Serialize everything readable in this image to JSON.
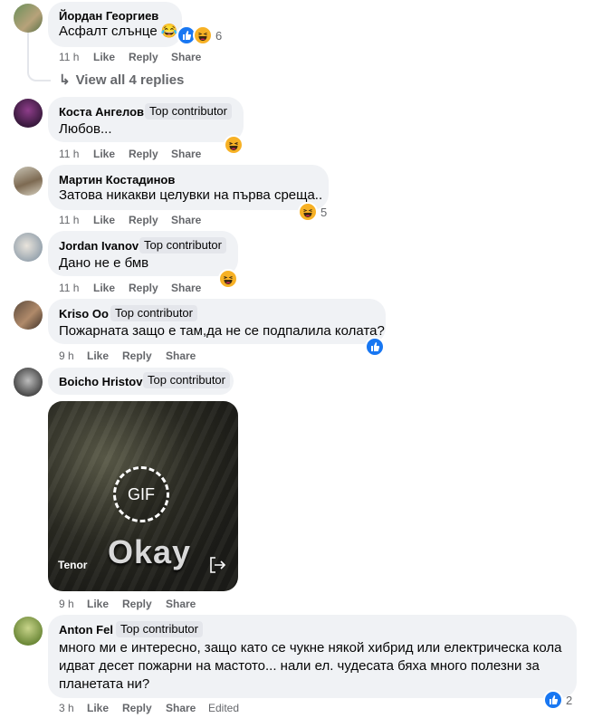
{
  "comments": [
    {
      "name": "Йордан Георгиев",
      "badge": "",
      "text": [
        "Асфалт слънце 😂"
      ],
      "time": "11 h",
      "like": "Like",
      "reply": "Reply",
      "share": "Share",
      "reactions": [
        "like",
        "haha"
      ],
      "count": "6"
    },
    {
      "name": "Коста Ангелов",
      "badge": "Top contributor",
      "text": [
        "Любов..."
      ],
      "time": "11 h",
      "like": "Like",
      "reply": "Reply",
      "share": "Share",
      "reactions": [
        "haha"
      ],
      "count": ""
    },
    {
      "name": "Мартин Костадинов",
      "badge": "",
      "text": [
        "Затова никакви целувки на първа среща.."
      ],
      "time": "11 h",
      "like": "Like",
      "reply": "Reply",
      "share": "Share",
      "reactions": [
        "haha"
      ],
      "count": "5"
    },
    {
      "name": "Jordan Ivanov",
      "badge": "Top contributor",
      "text": [
        "Дано не е бмв"
      ],
      "time": "11 h",
      "like": "Like",
      "reply": "Reply",
      "share": "Share",
      "reactions": [
        "haha"
      ],
      "count": ""
    },
    {
      "name": "Kriso Oo",
      "badge": "Top contributor",
      "text": [
        "Пожарната защо е там,да не се подпалила колата?"
      ],
      "time": "9 h",
      "like": "Like",
      "reply": "Reply",
      "share": "Share",
      "reactions": [
        "like"
      ],
      "count": ""
    },
    {
      "name": "Boicho Hristov",
      "badge": "Top contributor",
      "text": [],
      "time": "9 h",
      "like": "Like",
      "reply": "Reply",
      "share": "Share",
      "reactions": [],
      "count": ""
    },
    {
      "name": "Anton Fel",
      "badge": "Top contributor",
      "text": [
        "много ми е интересно, защо като се чукне някой хибрид или електрическа кола",
        "идват десет пожарни на мастото... нали ел. чудесата бяха много полезни за",
        "планетата ни?"
      ],
      "time": "3 h",
      "like": "Like",
      "reply": "Reply",
      "share": "Share",
      "edited": "Edited",
      "reactions": [
        "like"
      ],
      "count": "2"
    }
  ],
  "view_replies": "View all 4 replies",
  "gif": {
    "badge": "GIF",
    "caption": "Okay",
    "provider": "Tenor"
  },
  "colors": {
    "bubble": "#f0f2f5",
    "meta": "#65676b",
    "like": "#1877f2",
    "haha": "#f7b125",
    "badge": "#e4e6eb"
  }
}
